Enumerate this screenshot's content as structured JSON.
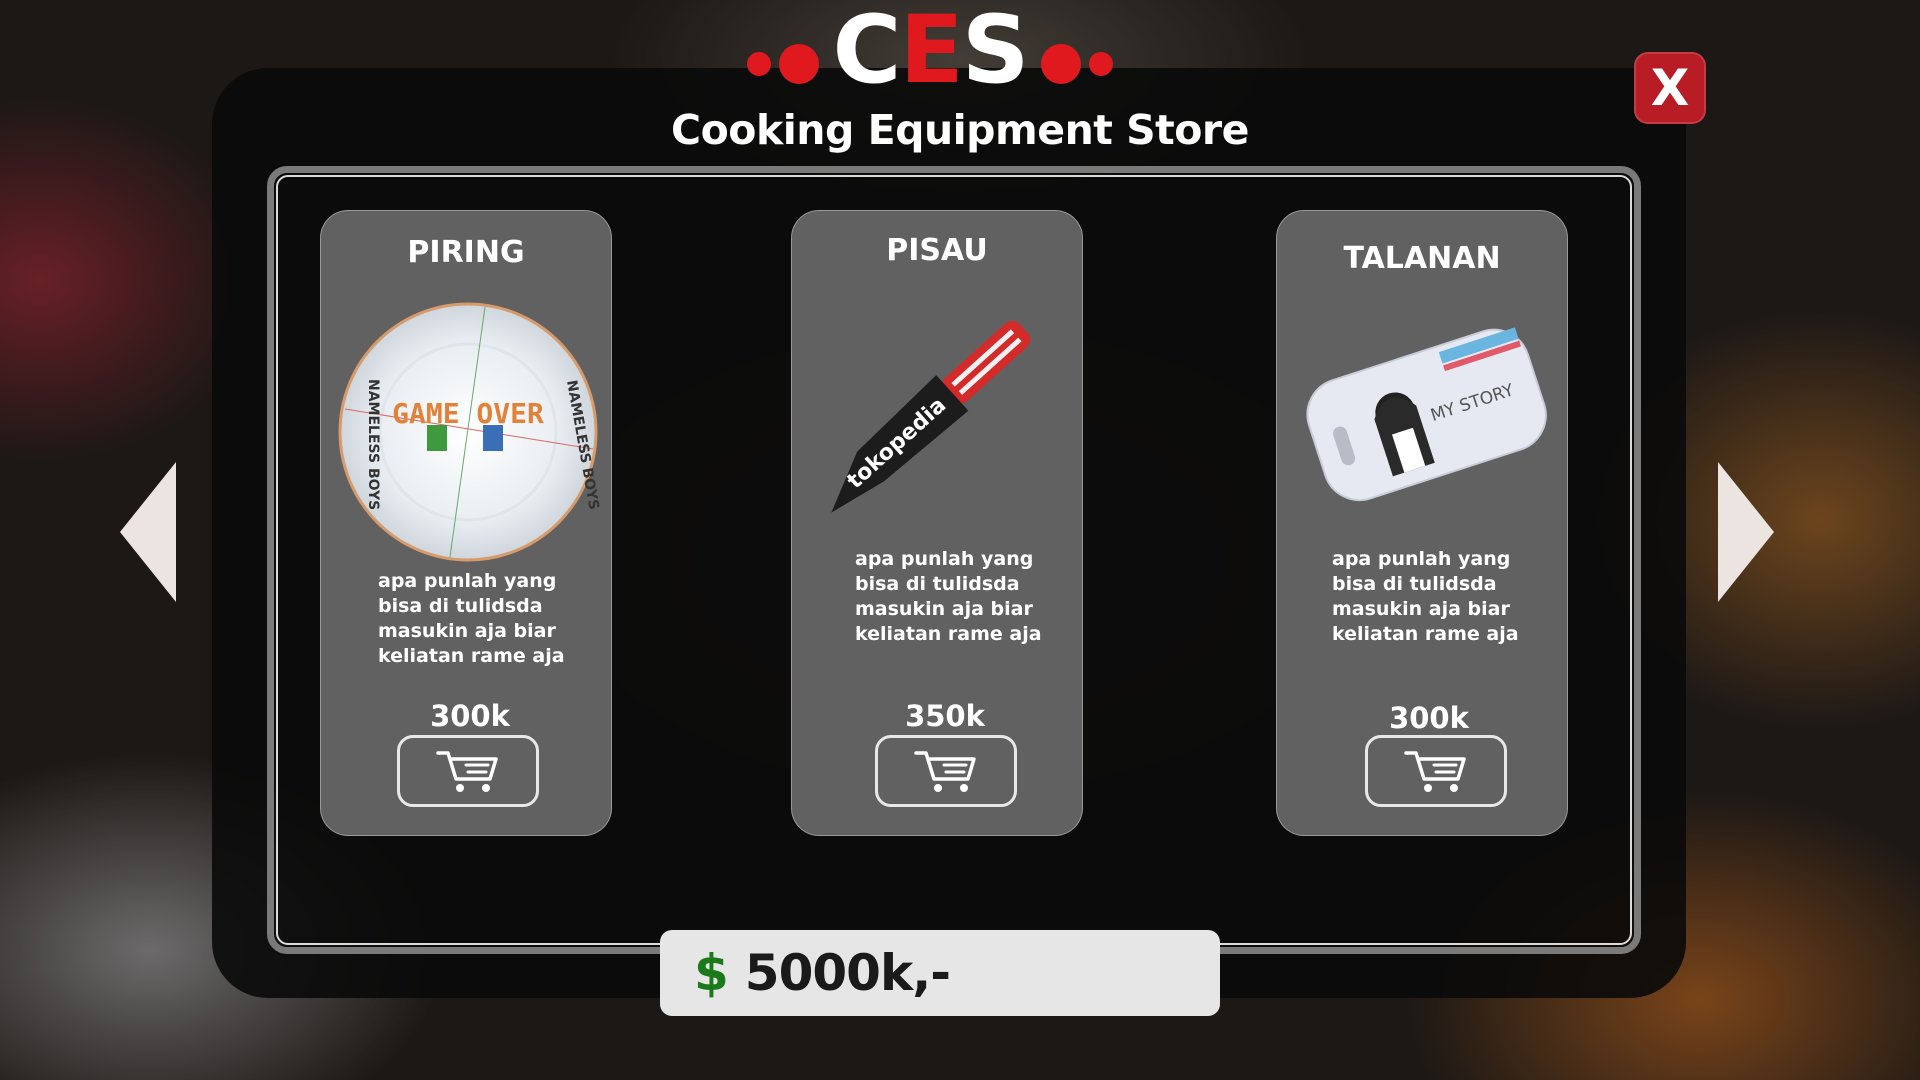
{
  "header": {
    "logo_parts": [
      "C",
      "E",
      "S"
    ],
    "subtitle": "Cooking Equipment Store",
    "close_label": "X"
  },
  "items": [
    {
      "name": "PIRING",
      "image": "plate-image",
      "plate_text": "GAME OVER",
      "plate_rim_text_left": "NAMELESS BOYS",
      "plate_rim_text_right": "NAMELESS BOYS",
      "description": "apa punlah yang bisa di tulidsda masukin aja biar keliatan rame aja",
      "price": "300k",
      "buy_icon": "cart-icon"
    },
    {
      "name": "PISAU",
      "image": "knife-image",
      "blade_text": "tokopedia",
      "description": "apa punlah yang bisa di tulidsda masukin aja biar keliatan rame aja",
      "price": "350k",
      "buy_icon": "cart-icon"
    },
    {
      "name": "TALANAN",
      "image": "cutting-board-image",
      "board_text": "MY STORY",
      "description": "apa punlah yang bisa di tulidsda masukin aja biar keliatan rame aja",
      "price": "300k",
      "buy_icon": "cart-icon"
    }
  ],
  "navigation": {
    "prev_icon": "arrow-left-icon",
    "next_icon": "arrow-right-icon"
  },
  "balance": {
    "currency_symbol": "$",
    "value": "5000k,-"
  },
  "colors": {
    "accent_red": "#e0191e",
    "close_red": "#b81c24",
    "money_green": "#1a7a1a"
  }
}
